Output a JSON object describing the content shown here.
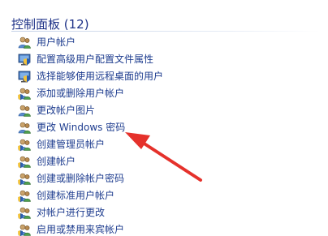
{
  "group": {
    "title": "控制面板 (12)"
  },
  "items": [
    {
      "label": "用户帐户",
      "icon": "users-icon"
    },
    {
      "label": "配置高级用户配置文件属性",
      "icon": "monitor-shield-icon"
    },
    {
      "label": "选择能够使用远程桌面的用户",
      "icon": "monitor-shield-icon"
    },
    {
      "label": "添加或删除用户帐户",
      "icon": "users-shield-icon"
    },
    {
      "label": "更改帐户图片",
      "icon": "users-icon"
    },
    {
      "label": "更改 Windows 密码",
      "icon": "users-icon"
    },
    {
      "label": "创建管理员帐户",
      "icon": "users-shield-icon"
    },
    {
      "label": "创建帐户",
      "icon": "users-shield-icon"
    },
    {
      "label": "创建或删除帐户密码",
      "icon": "users-shield-icon"
    },
    {
      "label": "创建标准用户帐户",
      "icon": "users-shield-icon"
    },
    {
      "label": "对帐户进行更改",
      "icon": "users-shield-icon"
    },
    {
      "label": "启用或禁用来宾帐户",
      "icon": "users-shield-icon"
    }
  ],
  "colors": {
    "header_text": "#1e3287",
    "link_text": "#1e3d8f",
    "annotation_arrow": "#e5312b"
  }
}
